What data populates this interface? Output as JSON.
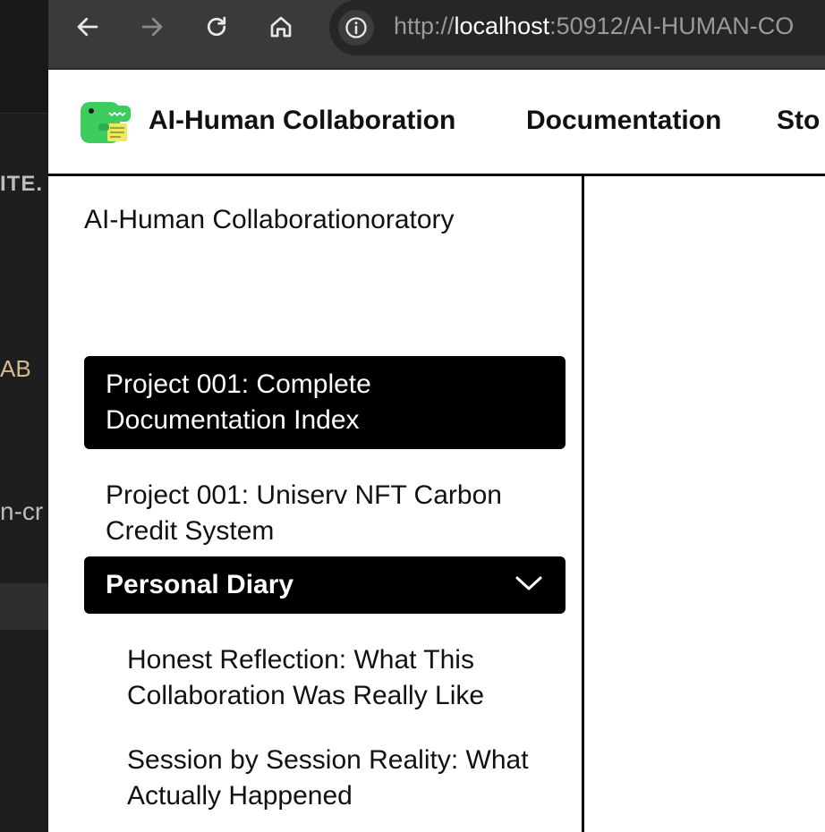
{
  "editor_background": {
    "line1": "ITE.",
    "line2": "AB",
    "line3": "n-cr"
  },
  "browser": {
    "url_scheme": "http://",
    "url_host": "localhost",
    "url_rest": ":50912/AI-HUMAN-CO",
    "buttons": {
      "back": "arrow-left-icon",
      "forward": "arrow-right-icon",
      "reload": "reload-icon",
      "home": "home-icon",
      "site_info": "info-icon"
    }
  },
  "header": {
    "brand": "AI-Human Collaboration",
    "nav": [
      "Documentation",
      "Sto"
    ]
  },
  "sidebar": {
    "title": "AI-Human Collaborationoratory",
    "items": [
      {
        "label": "Project 001: Complete Documentation Index",
        "active": true
      },
      {
        "label": "Project 001: Uniserv NFT Carbon Credit System",
        "active": false
      }
    ],
    "category": {
      "label": "Personal Diary",
      "icon": "chevron-down-icon",
      "expanded": true,
      "children": [
        "Honest Reflection: What This Collaboration Was Really Like",
        "Session by Session Reality: What Actually Happened"
      ]
    }
  },
  "colors": {
    "toolbar_bg": "#3a3a3a",
    "url_bar_bg": "#262626",
    "active_bg": "#000000",
    "logo_green": "#3ecc5f"
  }
}
